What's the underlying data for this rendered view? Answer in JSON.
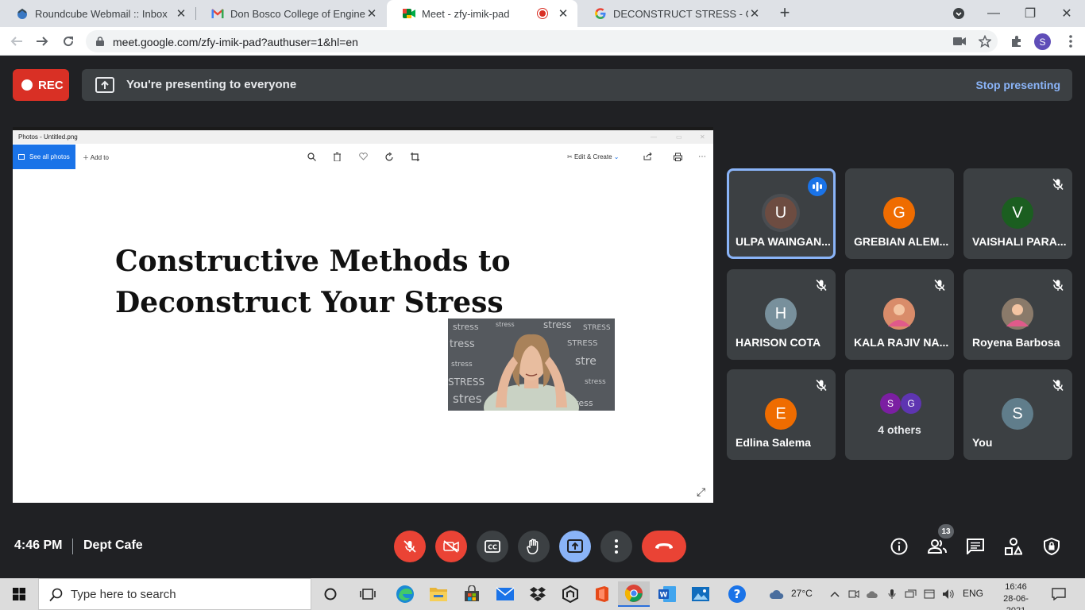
{
  "browser": {
    "tabs": [
      {
        "title": "Roundcube Webmail :: Inbox",
        "icon": "roundcube-icon"
      },
      {
        "title": "Don Bosco College of Engineerin",
        "icon": "gmail-icon"
      },
      {
        "title": "Meet - zfy-imik-pad",
        "icon": "meet-icon",
        "active": true,
        "recording": true
      },
      {
        "title": "DECONSTRUCT STRESS - Google",
        "icon": "google-icon"
      }
    ],
    "url": "meet.google.com/zfy-imik-pad?authuser=1&hl=en",
    "profile_initial": "S"
  },
  "meet": {
    "rec_label": "REC",
    "presenting_message": "You're presenting to everyone",
    "stop_presenting": "Stop presenting",
    "time": "4:46 PM",
    "meeting_name": "Dept Cafe",
    "participant_count": "13",
    "participants": [
      {
        "initial": "U",
        "name": "ULPA WAINGAN...",
        "color": "#6d4c41",
        "speaking": true,
        "muted": false
      },
      {
        "initial": "G",
        "name": "GREBIAN ALEM...",
        "color": "#ef6c00",
        "speaking": false,
        "muted": false
      },
      {
        "initial": "V",
        "name": "VAISHALI PARA...",
        "color": "#1b5e20",
        "speaking": false,
        "muted": true
      },
      {
        "initial": "H",
        "name": "HARISON COTA",
        "color": "#78909c",
        "speaking": false,
        "muted": true
      },
      {
        "initial": "",
        "name": "KALA RAJIV NA...",
        "color": "#d98c6a",
        "speaking": false,
        "muted": true,
        "photo": true
      },
      {
        "initial": "",
        "name": "Royena Barbosa",
        "color": "#8a7a6a",
        "speaking": false,
        "muted": true,
        "photo": true
      },
      {
        "initial": "E",
        "name": "Edlina Salema",
        "color": "#ef6c00",
        "speaking": false,
        "muted": true
      },
      {
        "initial": "S",
        "name": "You",
        "color": "#607d8b",
        "speaking": false,
        "muted": true
      }
    ],
    "others": {
      "label": "4 others",
      "initials": [
        "S",
        "G"
      ],
      "colors": [
        "#7b1fa2",
        "#5e35b1"
      ]
    }
  },
  "shared_screen": {
    "window_title": "Photos - Untitled.png",
    "see_all_photos": "See all photos",
    "add_to": "Add to",
    "edit_create": "Edit & Create",
    "slide_title_line1": "Constructive Methods to",
    "slide_title_line2": "Deconstruct Your Stress"
  },
  "taskbar": {
    "search_placeholder": "Type here to search",
    "weather": "27°C",
    "language": "ENG",
    "time": "16:46",
    "date": "28-06-2021"
  }
}
